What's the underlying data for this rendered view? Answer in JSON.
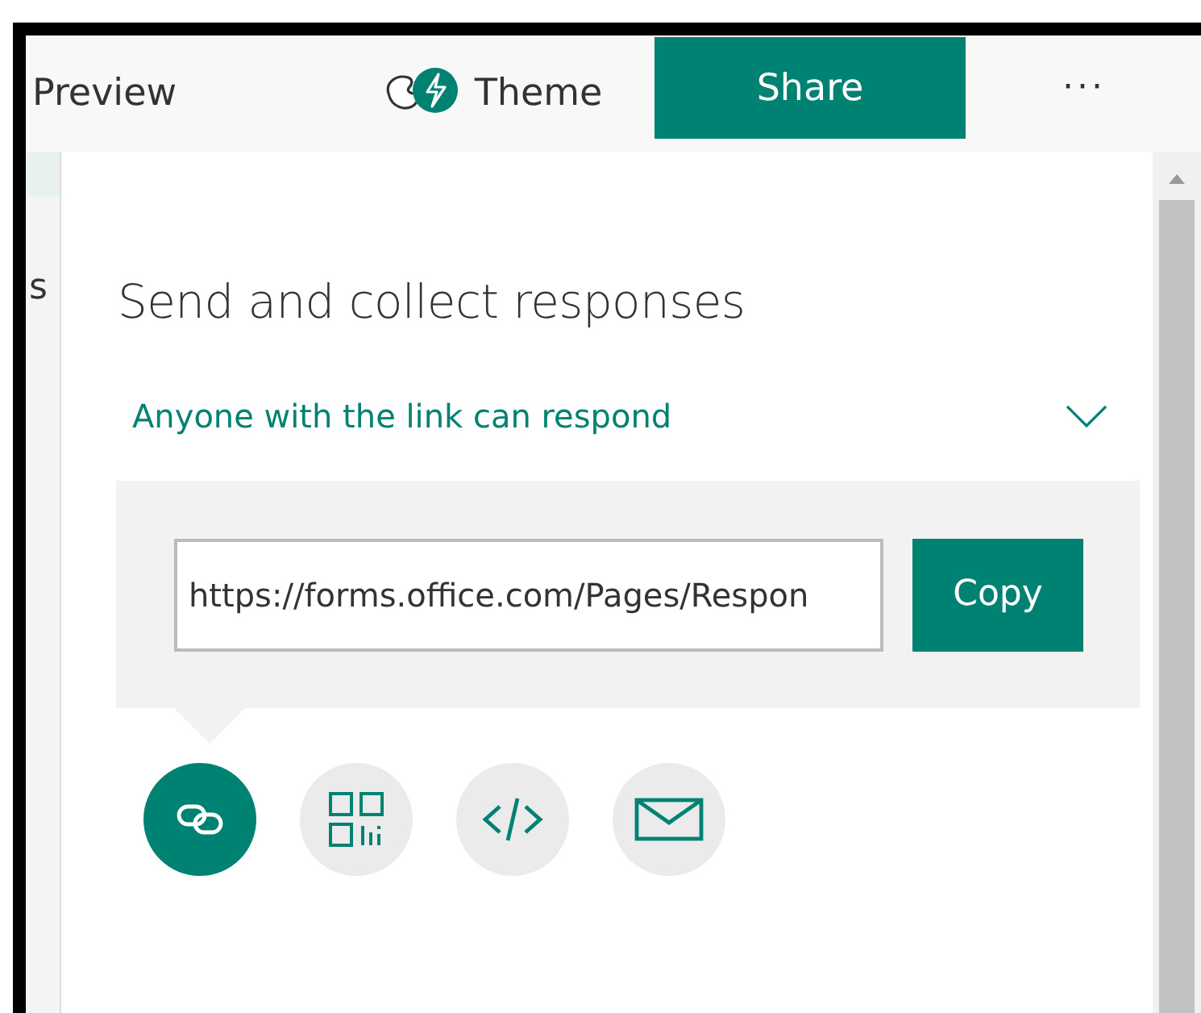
{
  "toolbar": {
    "tabs": [
      {
        "label": "Preview",
        "kind": "text",
        "selected": false
      },
      {
        "label": "Theme",
        "kind": "theme",
        "selected": false
      },
      {
        "label": "Share",
        "kind": "text",
        "selected": true
      }
    ],
    "more": "···"
  },
  "side_text": "s",
  "share_panel": {
    "title": "Send and collect responses",
    "audience": {
      "label": "Anyone with the link can respond",
      "expanded": false
    },
    "link": {
      "value": "https://forms.office.com/Pages/Respon"
    },
    "copy_button": "Copy",
    "methods": [
      {
        "kind": "link",
        "selected": true
      },
      {
        "kind": "qr",
        "selected": false
      },
      {
        "kind": "embed",
        "selected": false
      },
      {
        "kind": "email",
        "selected": false
      }
    ]
  }
}
